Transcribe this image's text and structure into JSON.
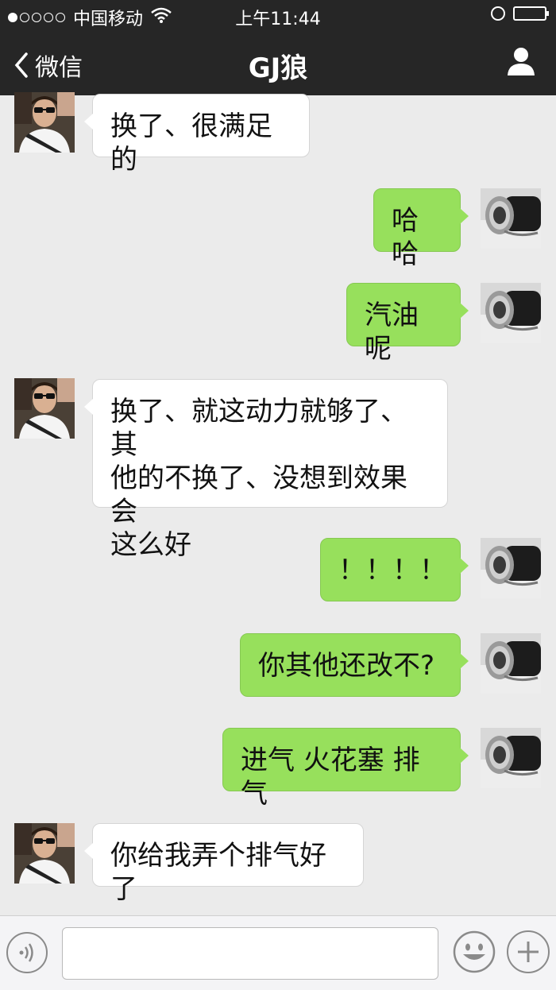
{
  "status_bar": {
    "carrier": "中国移动",
    "time": "上午11:44"
  },
  "nav": {
    "back_label": "微信",
    "title": "GJ狼"
  },
  "messages": [
    {
      "side": "left",
      "text": "换了、很满足的"
    },
    {
      "side": "right",
      "text": "哈哈"
    },
    {
      "side": "right",
      "text": "汽油呢"
    },
    {
      "side": "left",
      "lines": [
        "换了、就这动力就够了、其",
        "他的不换了、没想到效果会",
        "这么好"
      ]
    },
    {
      "side": "right",
      "text": "！！！！"
    },
    {
      "side": "right",
      "text": "你其他还改不?"
    },
    {
      "side": "right",
      "text": "进气 火花塞 排气"
    },
    {
      "side": "left",
      "text": "你给我弄个排气好了"
    }
  ],
  "input_bar": {
    "placeholder": ""
  },
  "colors": {
    "header": "#262626",
    "chat_bg": "#ebebeb",
    "sent_bubble": "#97e05c",
    "received_bubble": "#ffffff"
  },
  "icons": [
    "wifi-icon",
    "lock-icon",
    "battery-icon",
    "back-chevron-icon",
    "contact-icon",
    "voice-icon",
    "emoji-icon",
    "plus-icon"
  ]
}
